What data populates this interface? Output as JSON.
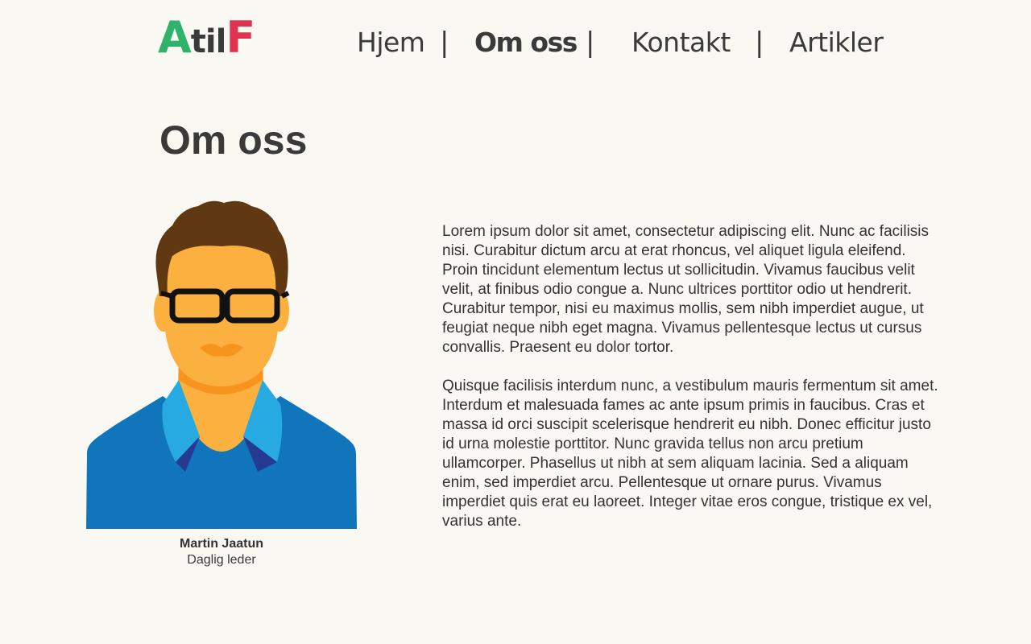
{
  "logo": {
    "part_a": "A",
    "part_til": "til",
    "part_f": "F",
    "colors": {
      "a": "#2fb36b",
      "til": "#3a3a3a",
      "f": "#e0334f"
    }
  },
  "nav": {
    "items": [
      {
        "label": "Hjem",
        "active": false
      },
      {
        "label": "Om oss",
        "active": true
      },
      {
        "label": "Kontakt",
        "active": false
      },
      {
        "label": "Artikler",
        "active": false
      }
    ],
    "separator": "|"
  },
  "page": {
    "title": "Om oss"
  },
  "person": {
    "name": "Martin Jaatun",
    "role": "Daglig leder",
    "avatar_icon": "man-with-glasses-avatar-icon"
  },
  "content": {
    "paragraphs": [
      "Lorem ipsum dolor sit amet, consectetur adipiscing elit. Nunc ac facilisis nisi. Curabitur dictum arcu at erat rhoncus, vel aliquet ligula eleifend. Proin tincidunt elementum lectus ut sollicitudin. Vivamus faucibus velit velit, at finibus odio congue a. Nunc ultrices porttitor odio ut hendrerit. Curabitur tempor, nisi eu maximus mollis, sem nibh imperdiet augue, ut feugiat neque nibh eget magna. Vivamus pellentesque lectus ut cursus convallis. Praesent eu dolor tortor.",
      "Quisque facilisis interdum nunc, a vestibulum mauris fermentum sit amet. Interdum et malesuada fames ac ante ipsum primis in faucibus. Cras et massa id orci suscipit scelerisque hendrerit eu nibh. Donec efficitur justo id urna molestie porttitor. Nunc gravida tellus non arcu pretium ullamcorper. Phasellus ut nibh at sem aliquam lacinia. Sed a aliquam enim, sed imperdiet arcu. Pellentesque ut ornare purus. Vivamus imperdiet quis erat eu laoreet. Integer vitae eros congue, tristique ex vel, varius ante."
    ]
  },
  "colors": {
    "background": "#f9f8f2",
    "text": "#3a3a3a",
    "skin": "#fbb040",
    "hair": "#603913",
    "shirt": "#1075bb",
    "collar": "#27aae1",
    "tie_dark": "#263a91"
  }
}
